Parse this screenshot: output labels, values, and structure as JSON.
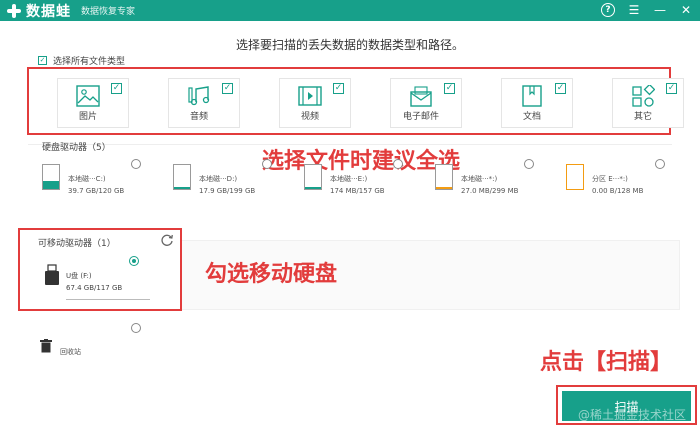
{
  "app": {
    "name": "数据蛙",
    "subtitle": "数据恢复专家"
  },
  "instruction": "选择要扫描的丢失数据的数据类型和路径。",
  "select_all_label": "选择所有文件类型",
  "file_types": [
    {
      "label": "图片",
      "icon": "image-icon",
      "checked": true
    },
    {
      "label": "音频",
      "icon": "music-icon",
      "checked": true
    },
    {
      "label": "视频",
      "icon": "video-icon",
      "checked": true
    },
    {
      "label": "电子邮件",
      "icon": "email-icon",
      "checked": true
    },
    {
      "label": "文档",
      "icon": "document-icon",
      "checked": true
    },
    {
      "label": "其它",
      "icon": "other-icon",
      "checked": true
    }
  ],
  "callouts": {
    "select_types": "选择文件时建议全选",
    "check_removable": "勾选移动硬盘",
    "click_scan": "点击【扫描】"
  },
  "hard_drives": {
    "label": "硬盘驱动器（5）",
    "items": [
      {
        "name": "本地磁···C:)",
        "size": "39.7 GB/120 GB",
        "fill_color": "#17a08a",
        "fill_fraction": 0.33
      },
      {
        "name": "本地磁···D:)",
        "size": "17.9 GB/199 GB",
        "fill_color": "#17a08a",
        "fill_fraction": 0.09
      },
      {
        "name": "本地磁···E:)",
        "size": "174 MB/157 GB",
        "fill_color": "#17a08a",
        "fill_fraction": 0.01
      },
      {
        "name": "本地磁···*:)",
        "size": "27.0 MB/299 MB",
        "fill_color": "#f39c12",
        "fill_fraction": 0.09
      },
      {
        "name": "分区 E···*:)",
        "size": "0.00  B/128 MB",
        "fill_color": "#f39c12",
        "fill_fraction": 0.0
      }
    ]
  },
  "removable": {
    "label": "可移动驱动器（1）",
    "item": {
      "name": "U盘 (F:)",
      "size": "67.4 GB/117 GB",
      "selected": true
    }
  },
  "recycle_bin_label": "回收站",
  "scan_button_label": "扫描",
  "watermark": "@稀土掘金技术社区",
  "colors": {
    "brand": "#17a08a",
    "annotation": "#e23c3c"
  }
}
